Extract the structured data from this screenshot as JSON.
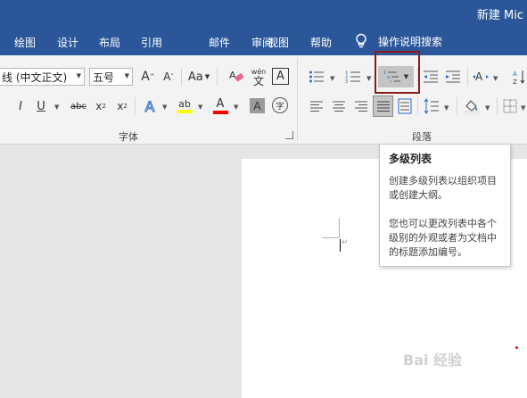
{
  "window": {
    "title": "新建 Mic"
  },
  "tabs": [
    {
      "label": "绘图"
    },
    {
      "label": "设计"
    },
    {
      "label": "布局"
    },
    {
      "label": "引用"
    },
    {
      "label": "邮件"
    },
    {
      "label": "审阅"
    },
    {
      "label": "视图"
    },
    {
      "label": "帮助"
    }
  ],
  "tell_me": {
    "label": "操作说明搜索",
    "icon": "lightbulb-icon"
  },
  "font": {
    "name": "线 (中文正文)",
    "size": "五号",
    "grow_label": "A",
    "shrink_label": "A",
    "case_label": "Aa",
    "phonetic_label": "wén",
    "phonetic_char": "文",
    "border_char": "A",
    "bold": "I",
    "underline": "U",
    "strike": "abc",
    "subscript": "x",
    "subscript_sub": "2",
    "superscript": "x",
    "superscript_sup": "2",
    "effects": "A",
    "highlight": "ab",
    "color_letter": "A",
    "shading_letter": "A",
    "enclose_char": "字",
    "highlight_color": "#ffff00",
    "font_color": "#ff0000"
  },
  "groups": {
    "font": "字体",
    "paragraph": "段落"
  },
  "paragraph": {
    "multilevel_list_label": "多级列表"
  },
  "tooltip": {
    "title": "多级列表",
    "p1": "创建多级列表以组织项目或创建大纲。",
    "p2": "您也可以更改列表中各个级别的外观或者为文档中的标题添加编号。"
  },
  "watermark": {
    "text": "Bai  经验"
  },
  "colors": {
    "title_bar": "#2b579a",
    "ribbon": "#f3f3f3",
    "highlight_box": "#8b1a1a"
  }
}
